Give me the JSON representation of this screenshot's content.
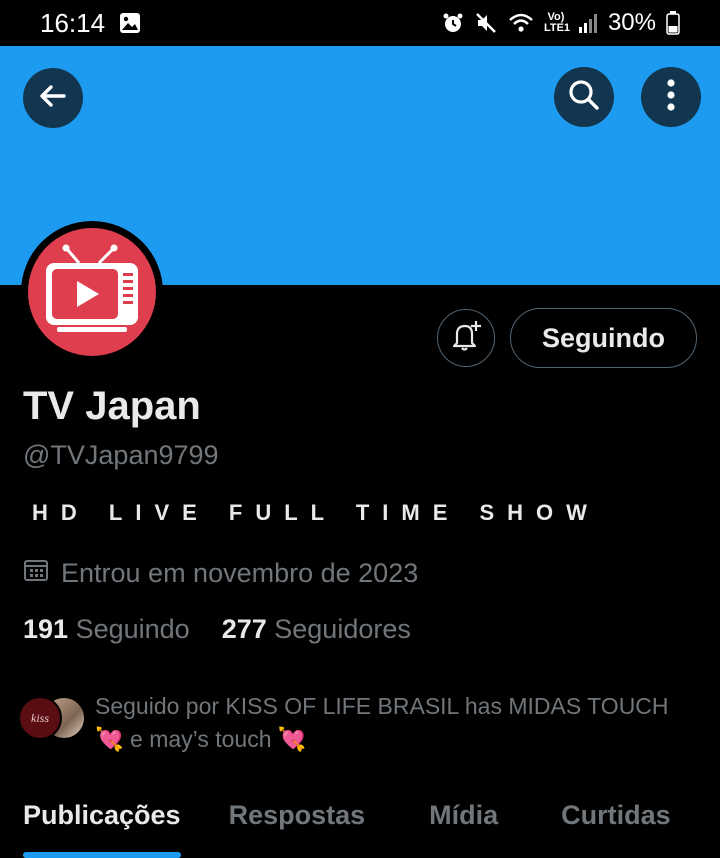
{
  "status_bar": {
    "time": "16:14",
    "battery": "30%",
    "network_label": "Vo) LTE1",
    "icons": [
      "gallery-icon",
      "alarm-icon",
      "mute-icon",
      "wifi-icon",
      "signal-icon",
      "battery-icon"
    ]
  },
  "header": {
    "back_icon": "arrow-left-icon",
    "search_icon": "search-icon",
    "more_icon": "more-vertical-icon",
    "banner_color": "#1d9bf0"
  },
  "profile": {
    "avatar_icon": "tv-play-icon",
    "avatar_color": "#df3e4f",
    "notify_icon": "bell-plus-icon",
    "follow_button_label": "Seguindo",
    "display_name": "TV Japan",
    "handle": "@TVJapan9799",
    "bio": "HD LIVE FULL TIME SHOW",
    "joined_icon": "calendar-icon",
    "joined": "Entrou em novembro de 2023",
    "following_count": "191",
    "following_label": "Seguindo",
    "followers_count": "277",
    "followers_label": "Seguidores",
    "followed_by": {
      "prefix": "Seguido por KISS OF LIFE BRASIL has MIDAS TOUCH",
      "emoji_1": "💘",
      "middle": " e may’s touch ",
      "emoji_2": "💘",
      "avatar_1_text": "kiss"
    }
  },
  "tabs": [
    {
      "label": "Publicações",
      "active": true
    },
    {
      "label": "Respostas",
      "active": false
    },
    {
      "label": "Mídia",
      "active": false
    },
    {
      "label": "Curtidas",
      "active": false
    }
  ],
  "colors": {
    "accent": "#1d9bf0",
    "background": "#000000",
    "text_primary": "#e7e9ea",
    "text_secondary": "#71767b",
    "border": "#536471"
  }
}
